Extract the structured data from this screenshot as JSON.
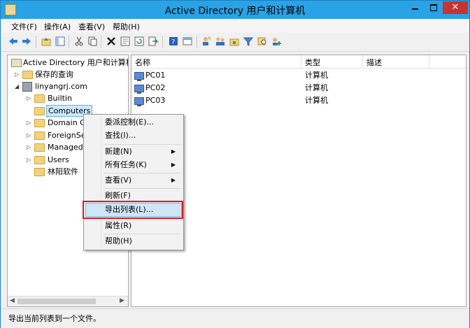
{
  "window": {
    "title": "Active Directory 用户和计算机",
    "controls": {
      "minimize": "",
      "maximize": "",
      "close": "✕"
    }
  },
  "menubar": [
    "文件(F)",
    "操作(A)",
    "查看(V)",
    "帮助(H)"
  ],
  "toolbar": {
    "icons": [
      "back-icon",
      "forward-icon",
      "up-folder-icon",
      "show-hide-tree-icon",
      "cut-icon",
      "copy-icon",
      "delete-icon",
      "properties-icon",
      "refresh-icon",
      "export-icon",
      "help-icon",
      "console-icon",
      "new-user-icon",
      "new-group-icon",
      "new-ou-icon",
      "filter-icon",
      "find-icon",
      "add-to-group-icon"
    ]
  },
  "tree": {
    "root": "Active Directory 用户和计算机",
    "saved_queries": "保存的查询",
    "domain": "linyangrj.com",
    "children": [
      "Builtin",
      "Computers",
      "Domain Co",
      "ForeignSec",
      "Managed",
      "Users",
      "林阳软件"
    ],
    "selected": "Computers"
  },
  "list": {
    "columns": [
      "名称",
      "类型",
      "描述"
    ],
    "rows": [
      {
        "name": "PC01",
        "type": "计算机",
        "description": ""
      },
      {
        "name": "PC02",
        "type": "计算机",
        "description": ""
      },
      {
        "name": "PC03",
        "type": "计算机",
        "description": ""
      }
    ]
  },
  "context_menu": {
    "items": [
      {
        "label": "委派控制(E)...",
        "submenu": false
      },
      {
        "label": "查找(I)...",
        "submenu": false
      },
      {
        "label": "新建(N)",
        "submenu": true
      },
      {
        "label": "所有任务(K)",
        "submenu": true
      },
      {
        "label": "查看(V)",
        "submenu": true
      },
      {
        "label": "刷新(F)",
        "submenu": false
      },
      {
        "label": "导出列表(L)...",
        "submenu": false,
        "highlighted": true
      },
      {
        "label": "属性(R)",
        "submenu": false
      },
      {
        "label": "帮助(H)",
        "submenu": false
      }
    ],
    "submenu_arrow": "▶"
  },
  "statusbar": {
    "text": "导出当前列表到一个文件。"
  },
  "colors": {
    "titlebar": "#29a2e6",
    "close": "#c7332f",
    "highlight": "#e3191c"
  }
}
